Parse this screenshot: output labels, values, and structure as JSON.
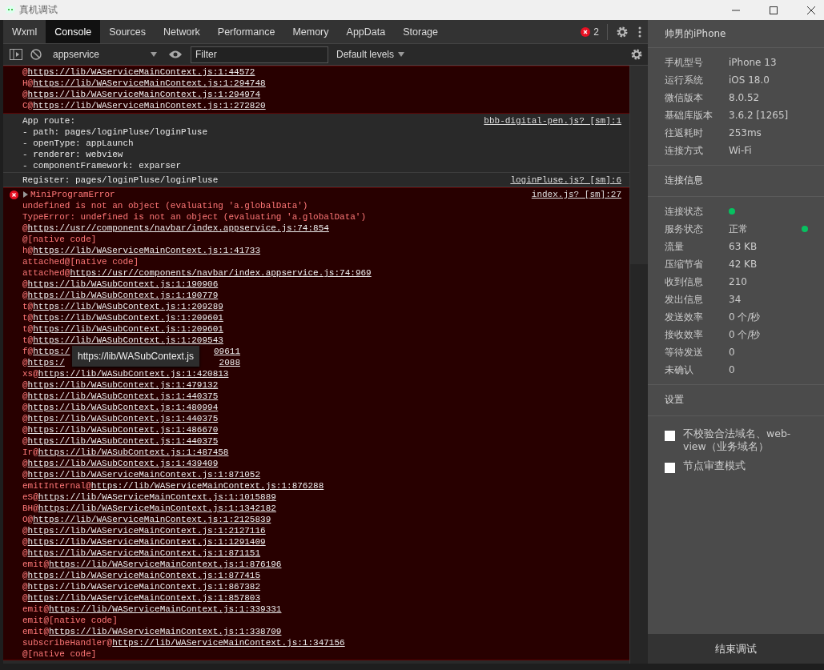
{
  "window": {
    "title": "真机调试"
  },
  "tabs": [
    {
      "label": "Wxml",
      "selected": false
    },
    {
      "label": "Console",
      "selected": true
    },
    {
      "label": "Sources",
      "selected": false
    },
    {
      "label": "Network",
      "selected": false
    },
    {
      "label": "Performance",
      "selected": false
    },
    {
      "label": "Memory",
      "selected": false
    },
    {
      "label": "AppData",
      "selected": false
    },
    {
      "label": "Storage",
      "selected": false
    }
  ],
  "error_count": "2",
  "toolbar": {
    "context": "appservice",
    "filter": {
      "placeholder": "Filter"
    },
    "levels": "Default levels"
  },
  "console": [
    {
      "kind": "error_tail",
      "stack": [
        {
          "prefix": "@",
          "url": "https://lib/WAServiceMainContext.js:1:44572"
        },
        {
          "prefix": "H@",
          "url": "https://lib/WAServiceMainContext.js:1:294748"
        },
        {
          "prefix": "@",
          "url": "https://lib/WAServiceMainContext.js:1:294974"
        },
        {
          "prefix": "C@",
          "url": "https://lib/WAServiceMainContext.js:1:272820"
        }
      ]
    },
    {
      "kind": "log",
      "lines": [
        "App route:",
        "- path: pages/loginPluse/loginPluse",
        "- openType: appLaunch",
        "- renderer: webview",
        "- componentFramework: exparser"
      ],
      "source": "bbb-digital-pen.js? [sm]:1"
    },
    {
      "kind": "log",
      "lines": [
        "Register: pages/loginPluse/loginPluse"
      ],
      "source": "loginPluse.js? [sm]:6"
    },
    {
      "kind": "error",
      "title": "MiniProgramError",
      "source": "index.js? [sm]:27",
      "messages": [
        "undefined is not an object (evaluating 'a.globalData')",
        "TypeError: undefined is not an object (evaluating 'a.globalData')"
      ],
      "stack": [
        {
          "prefix": "@",
          "url": "https://usr//components/navbar/index.appservice.js:74:854"
        },
        {
          "prefix": "@[native code]"
        },
        {
          "prefix": "h@",
          "url": "https://lib/WAServiceMainContext.js:1:41733"
        },
        {
          "prefix": "attached@[native code]"
        },
        {
          "prefix": "attached@",
          "url": "https://usr//components/navbar/index.appservice.js:74:969"
        },
        {
          "prefix": "@",
          "url": "https://lib/WASubContext.js:1:190906"
        },
        {
          "prefix": "@",
          "url": "https://lib/WASubContext.js:1:190779"
        },
        {
          "prefix": "t@",
          "url": "https://lib/WASubContext.js:1:209289"
        },
        {
          "prefix": "t@",
          "url": "https://lib/WASubContext.js:1:209601"
        },
        {
          "prefix": "t@",
          "url": "https://lib/WASubContext.js:1:209601"
        },
        {
          "prefix": "t@",
          "url": "https://lib/WASubContext.js:1:209543"
        },
        {
          "prefix": "f@",
          "url": "https:/",
          "after": "09611",
          "tooltip": "https://lib/WASubContext.js"
        },
        {
          "prefix": "@",
          "url": "https:/",
          "after": "2088"
        },
        {
          "prefix": "xs@",
          "url": "https://lib/WASubContext.js:1:420813"
        },
        {
          "prefix": "@",
          "url": "https://lib/WASubContext.js:1:479132"
        },
        {
          "prefix": "@",
          "url": "https://lib/WASubContext.js:1:440375"
        },
        {
          "prefix": "@",
          "url": "https://lib/WASubContext.js:1:480994"
        },
        {
          "prefix": "@",
          "url": "https://lib/WASubContext.js:1:440375"
        },
        {
          "prefix": "@",
          "url": "https://lib/WASubContext.js:1:486670"
        },
        {
          "prefix": "@",
          "url": "https://lib/WASubContext.js:1:440375"
        },
        {
          "prefix": "Ir@",
          "url": "https://lib/WASubContext.js:1:487458"
        },
        {
          "prefix": "@",
          "url": "https://lib/WASubContext.js:1:439409"
        },
        {
          "prefix": "@",
          "url": "https://lib/WAServiceMainContext.js:1:871052"
        },
        {
          "prefix": "emitInternal@",
          "url": "https://lib/WAServiceMainContext.js:1:876288"
        },
        {
          "prefix": "eS@",
          "url": "https://lib/WAServiceMainContext.js:1:1015889"
        },
        {
          "prefix": "BH@",
          "url": "https://lib/WAServiceMainContext.js:1:1342182"
        },
        {
          "prefix": "O@",
          "url": "https://lib/WAServiceMainContext.js:1:2125839"
        },
        {
          "prefix": "@",
          "url": "https://lib/WAServiceMainContext.js:1:2127116"
        },
        {
          "prefix": "@",
          "url": "https://lib/WAServiceMainContext.js:1:1291409"
        },
        {
          "prefix": "@",
          "url": "https://lib/WAServiceMainContext.js:1:871151"
        },
        {
          "prefix": "emit@",
          "url": "https://lib/WAServiceMainContext.js:1:876196"
        },
        {
          "prefix": "@",
          "url": "https://lib/WAServiceMainContext.js:1:877415"
        },
        {
          "prefix": "@",
          "url": "https://lib/WAServiceMainContext.js:1:867382"
        },
        {
          "prefix": "@",
          "url": "https://lib/WAServiceMainContext.js:1:857803"
        },
        {
          "prefix": "emit@",
          "url": "https://lib/WAServiceMainContext.js:1:339331"
        },
        {
          "prefix": "emit@[native code]"
        },
        {
          "prefix": "emit@",
          "url": "https://lib/WAServiceMainContext.js:1:338709"
        },
        {
          "prefix": "subscribeHandler@",
          "url": "https://lib/WAServiceMainContext.js:1:347156"
        },
        {
          "prefix": "@[native code]"
        }
      ]
    }
  ],
  "device": {
    "name": "帅男的iPhone",
    "info": [
      {
        "label": "手机型号",
        "value": "iPhone 13"
      },
      {
        "label": "运行系统",
        "value": "iOS 18.0"
      },
      {
        "label": "微信版本",
        "value": "8.0.52"
      },
      {
        "label": "基础库版本",
        "value": "3.6.2 [1265]"
      },
      {
        "label": "往返耗时",
        "value": "253ms"
      },
      {
        "label": "连接方式",
        "value": "Wi-Fi"
      }
    ]
  },
  "connection": {
    "title": "连接信息",
    "rows": [
      {
        "kind": "dot",
        "label": "连接状态"
      },
      {
        "kind": "text_dot",
        "label": "服务状态",
        "value": "正常"
      },
      {
        "kind": "text",
        "label": "流量",
        "value": "63 KB"
      },
      {
        "kind": "text",
        "label": "压缩节省",
        "value": "42 KB"
      },
      {
        "kind": "text",
        "label": "收到信息",
        "value": "210"
      },
      {
        "kind": "text",
        "label": "发出信息",
        "value": "34"
      },
      {
        "kind": "text",
        "label": "发送效率",
        "value": "0 个/秒"
      },
      {
        "kind": "text",
        "label": "接收效率",
        "value": "0 个/秒"
      },
      {
        "kind": "text",
        "label": "等待发送",
        "value": "0"
      },
      {
        "kind": "text",
        "label": "未确认",
        "value": "0"
      }
    ]
  },
  "settings": {
    "title": "设置",
    "options": [
      {
        "label": "不校验合法域名、web-view（业务域名）",
        "checked": false
      },
      {
        "label": "节点审查模式",
        "checked": false
      }
    ]
  },
  "end_button": "结束调试"
}
